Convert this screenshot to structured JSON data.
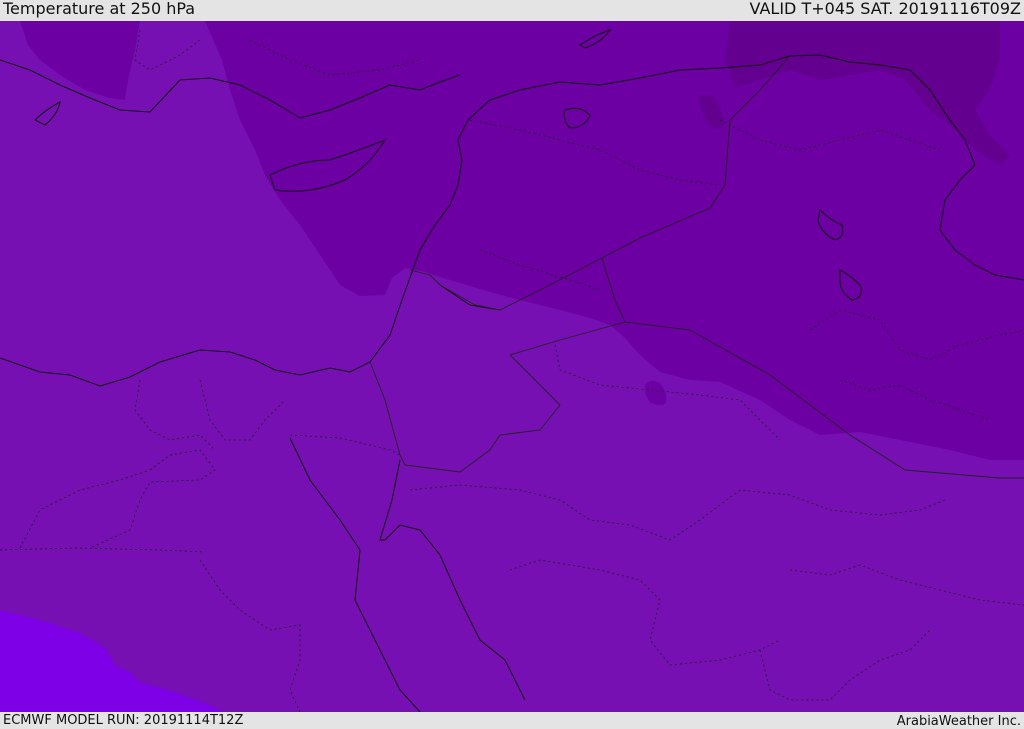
{
  "header": {
    "title": "Temperature at 250 hPa",
    "valid": "VALID T+045 SAT. 20191116T09Z"
  },
  "footer": {
    "model_run": "ECMWF MODEL RUN: 20191114T12Z",
    "credit": "ArabiaWeather Inc."
  },
  "map": {
    "colors": {
      "band_warm": "#7d00e6",
      "band_mid": "#7710b3",
      "band_cool": "#6c00a3",
      "band_cold": "#64008f",
      "coast_line": "#111111",
      "border_line": "#222222"
    }
  }
}
